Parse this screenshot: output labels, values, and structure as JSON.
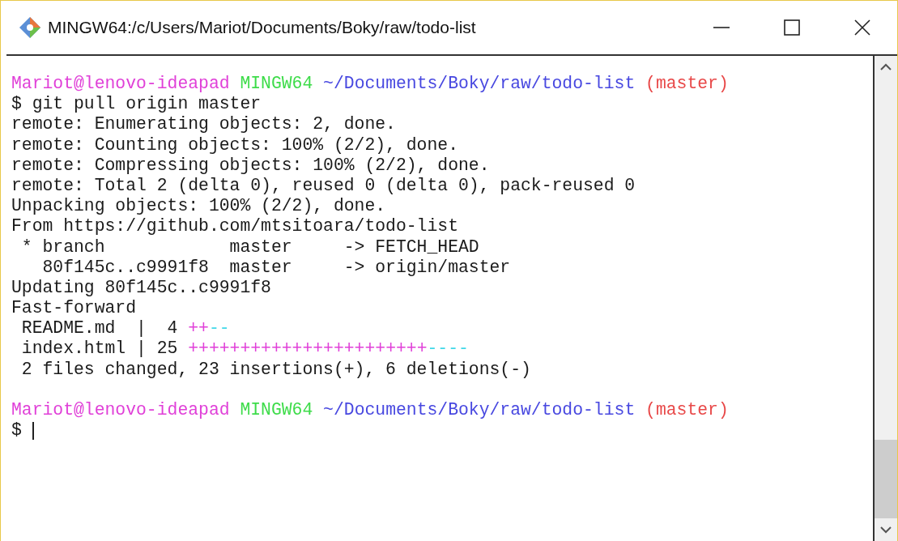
{
  "window": {
    "title": "MINGW64:/c/Users/Mariot/Documents/Boky/raw/todo-list"
  },
  "terminal": {
    "lines": [
      {
        "kind": "text",
        "segments": [
          {
            "text": "Mariot@lenovo-ideapad",
            "color": "#e040d8"
          },
          {
            "text": " MINGW64",
            "color": "#3edc4a"
          },
          {
            "text": " ~/Documents/Boky/raw/todo-list",
            "color": "#4848e0"
          },
          {
            "text": " (master)",
            "color": "#e84848"
          }
        ]
      },
      {
        "kind": "text",
        "segments": [
          {
            "text": "$ git pull origin master"
          }
        ]
      },
      {
        "kind": "text",
        "segments": [
          {
            "text": "remote: Enumerating objects: 2, done."
          }
        ]
      },
      {
        "kind": "text",
        "segments": [
          {
            "text": "remote: Counting objects: 100% (2/2), done."
          }
        ]
      },
      {
        "kind": "text",
        "segments": [
          {
            "text": "remote: Compressing objects: 100% (2/2), done."
          }
        ]
      },
      {
        "kind": "text",
        "segments": [
          {
            "text": "remote: Total 2 (delta 0), reused 0 (delta 0), pack-reused 0"
          }
        ]
      },
      {
        "kind": "text",
        "segments": [
          {
            "text": "Unpacking objects: 100% (2/2), done."
          }
        ]
      },
      {
        "kind": "text",
        "segments": [
          {
            "text": "From https://github.com/mtsitoara/todo-list"
          }
        ]
      },
      {
        "kind": "text",
        "segments": [
          {
            "text": " * branch            master     -> FETCH_HEAD"
          }
        ]
      },
      {
        "kind": "text",
        "segments": [
          {
            "text": "   80f145c..c9991f8  master     -> origin/master"
          }
        ]
      },
      {
        "kind": "text",
        "segments": [
          {
            "text": "Updating 80f145c..c9991f8"
          }
        ]
      },
      {
        "kind": "text",
        "segments": [
          {
            "text": "Fast-forward"
          }
        ]
      },
      {
        "kind": "text",
        "segments": [
          {
            "text": " README.md  |  4 "
          },
          {
            "text": "++",
            "color": "#e040d8"
          },
          {
            "text": "--",
            "color": "#40d8e8"
          }
        ]
      },
      {
        "kind": "text",
        "segments": [
          {
            "text": " index.html | 25 "
          },
          {
            "text": "+++++++++++++++++++++++",
            "color": "#e040d8"
          },
          {
            "text": "----",
            "color": "#40d8e8"
          }
        ]
      },
      {
        "kind": "text",
        "segments": [
          {
            "text": " 2 files changed, 23 insertions(+), 6 deletions(-)"
          }
        ]
      },
      {
        "kind": "blank"
      },
      {
        "kind": "text",
        "segments": [
          {
            "text": "Mariot@lenovo-ideapad",
            "color": "#e040d8"
          },
          {
            "text": " MINGW64",
            "color": "#3edc4a"
          },
          {
            "text": " ~/Documents/Boky/raw/todo-list",
            "color": "#4848e0"
          },
          {
            "text": " (master)",
            "color": "#e84848"
          }
        ]
      },
      {
        "kind": "prompt",
        "segments": [
          {
            "text": "$ "
          }
        ]
      }
    ]
  }
}
